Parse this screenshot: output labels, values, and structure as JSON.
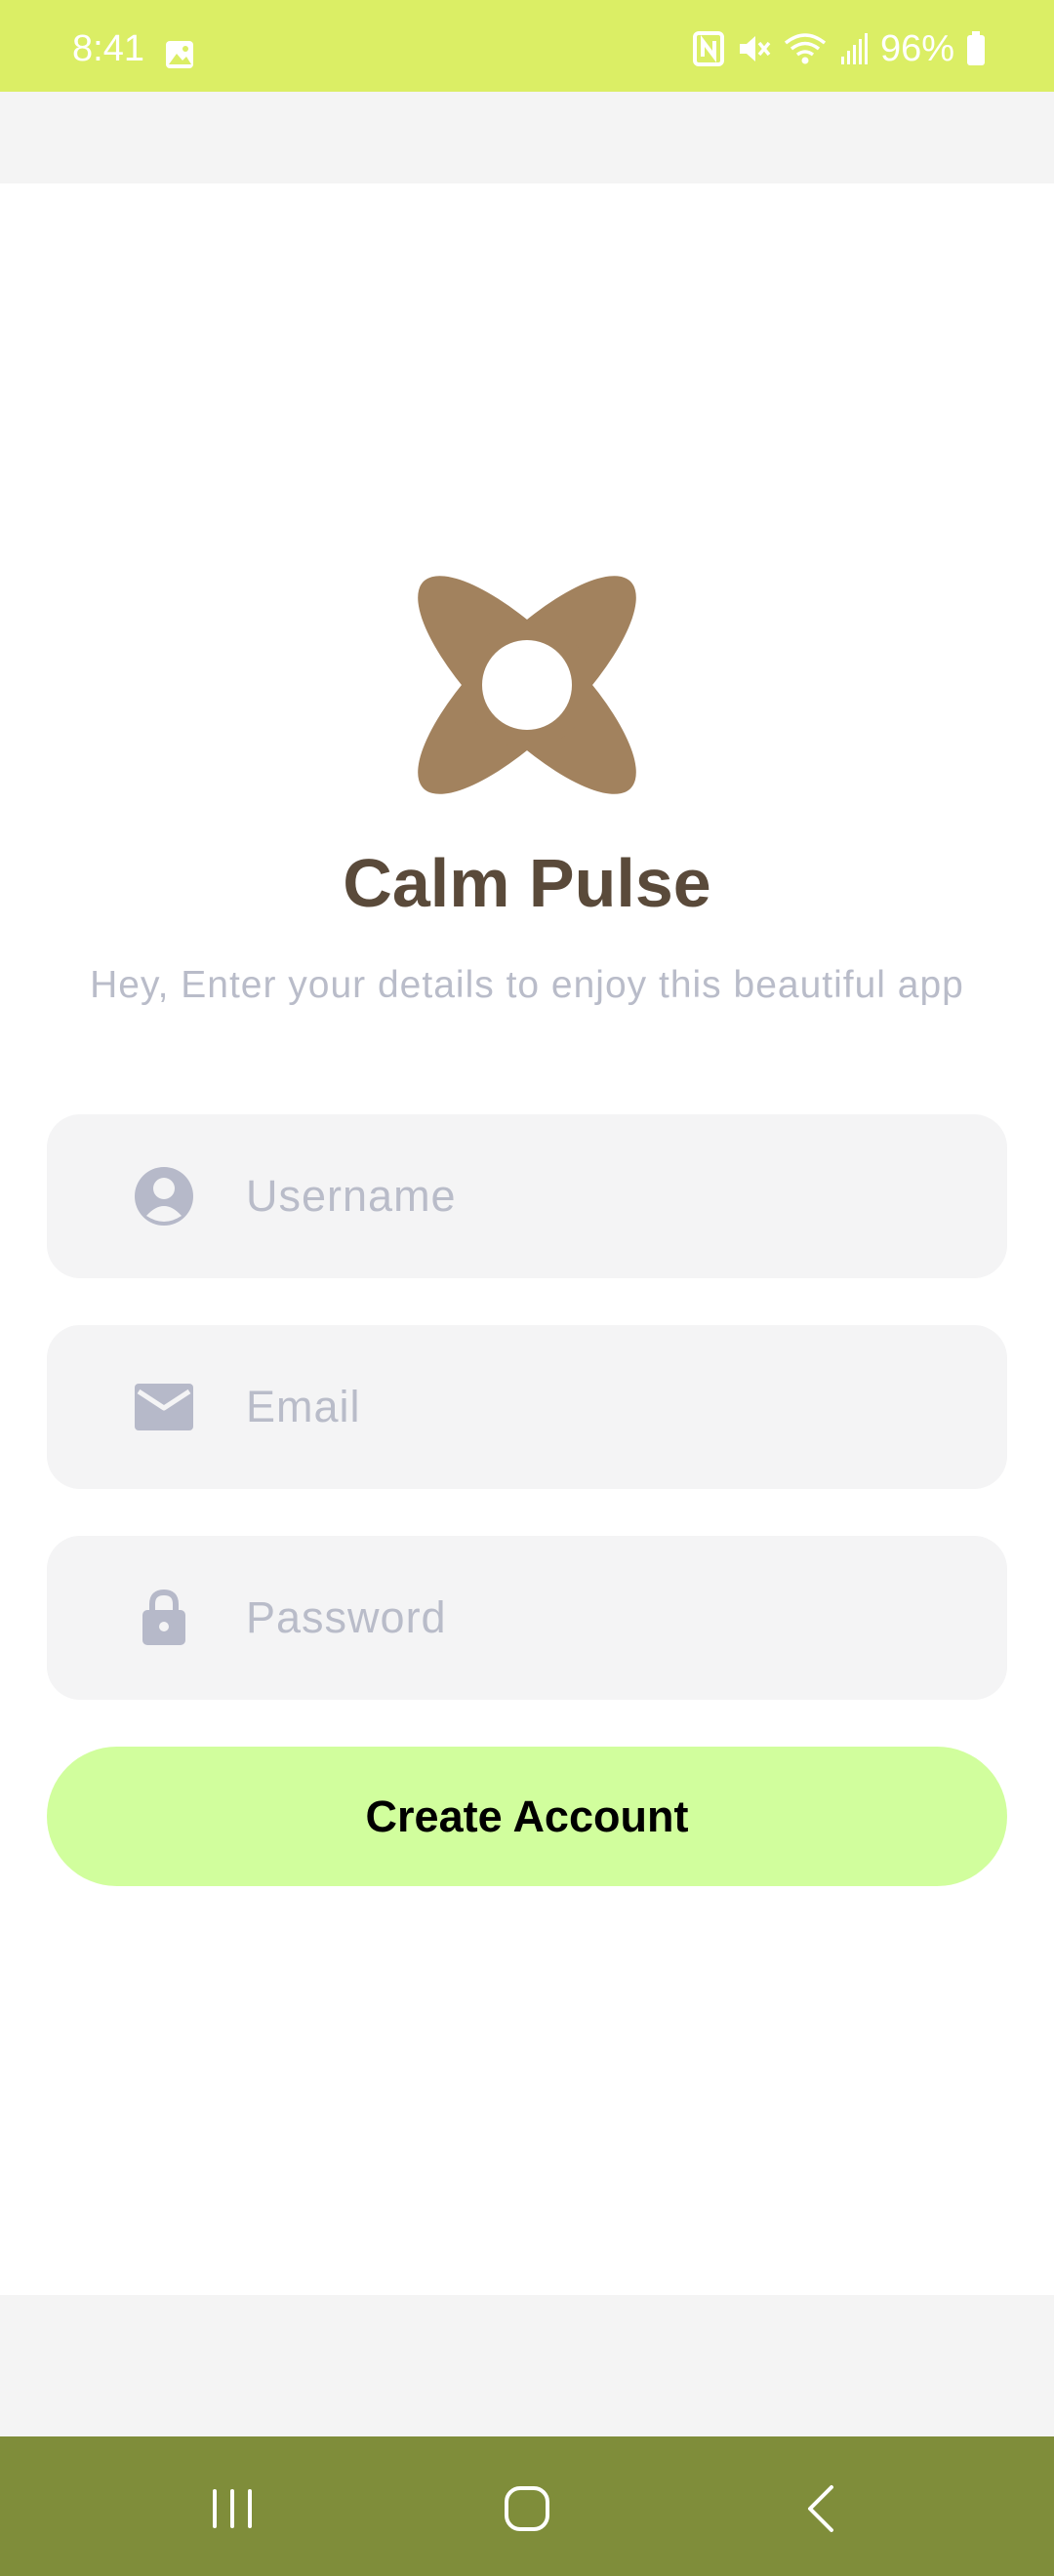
{
  "status_bar": {
    "time": "8:41",
    "battery": "96%",
    "icons": [
      "gallery-icon",
      "nfc-icon",
      "mute-icon",
      "wifi-icon",
      "signal-icon",
      "battery-icon"
    ]
  },
  "app": {
    "logo_icon": "flower-logo-icon",
    "title": "Calm Pulse",
    "subtitle": "Hey, Enter your details to enjoy this beautiful app"
  },
  "form": {
    "username": {
      "placeholder": "Username",
      "value": "",
      "icon": "user-icon"
    },
    "email": {
      "placeholder": "Email",
      "value": "",
      "icon": "mail-icon"
    },
    "password": {
      "placeholder": "Password",
      "value": "",
      "icon": "lock-icon"
    },
    "submit_label": "Create Account"
  },
  "nav_bar": {
    "buttons": [
      "recent-apps-icon",
      "home-icon",
      "back-icon"
    ]
  },
  "colors": {
    "status_bar": "#dbee65",
    "nav_bar": "#7f8d3a",
    "logo": "#a2825e",
    "title": "#5a4a3a",
    "subtitle": "#b9bcc9",
    "field_bg": "#f4f4f5",
    "button_bg": "#d1fe9d"
  }
}
